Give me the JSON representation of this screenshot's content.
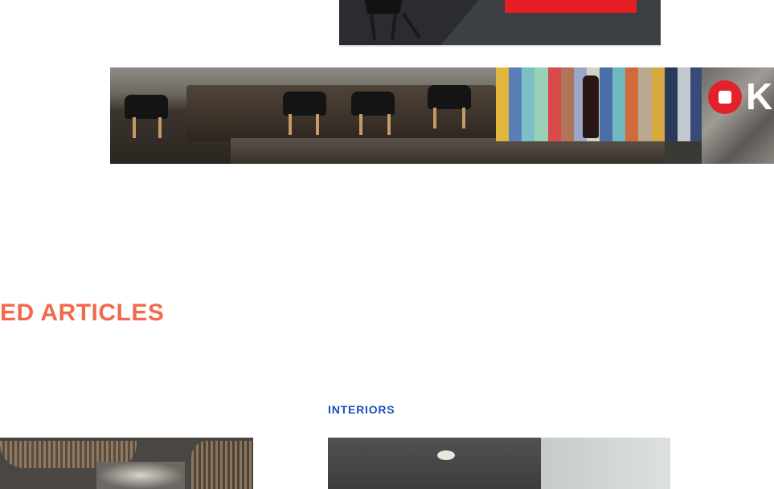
{
  "top_banner": {
    "cta_label": ""
  },
  "ad_strip": {
    "brand_letter": "K",
    "stripe_colors": [
      "#e0b73a",
      "#5a7fb8",
      "#7cc0c8",
      "#9bd0b8",
      "#d94a4a",
      "#b0745a",
      "#9aa7c8",
      "#d0d4c8",
      "#4a6fa8",
      "#6fb8c0",
      "#cf6a3a",
      "#b8a890",
      "#d8a840",
      "#2a3a5a",
      "#c0c8d0",
      "#3a4a78"
    ]
  },
  "section": {
    "heading": "ED ARTICLES"
  },
  "articles": [
    {
      "category": "",
      "thumbnail": "pendant-lamps-photo"
    },
    {
      "category": "INTERIORS",
      "thumbnail": "interior-room-photo"
    }
  ],
  "colors": {
    "heading": "#f26a4c",
    "category": "#1d4fb8",
    "cta": "#e51d24",
    "brand": "#e3212b"
  }
}
